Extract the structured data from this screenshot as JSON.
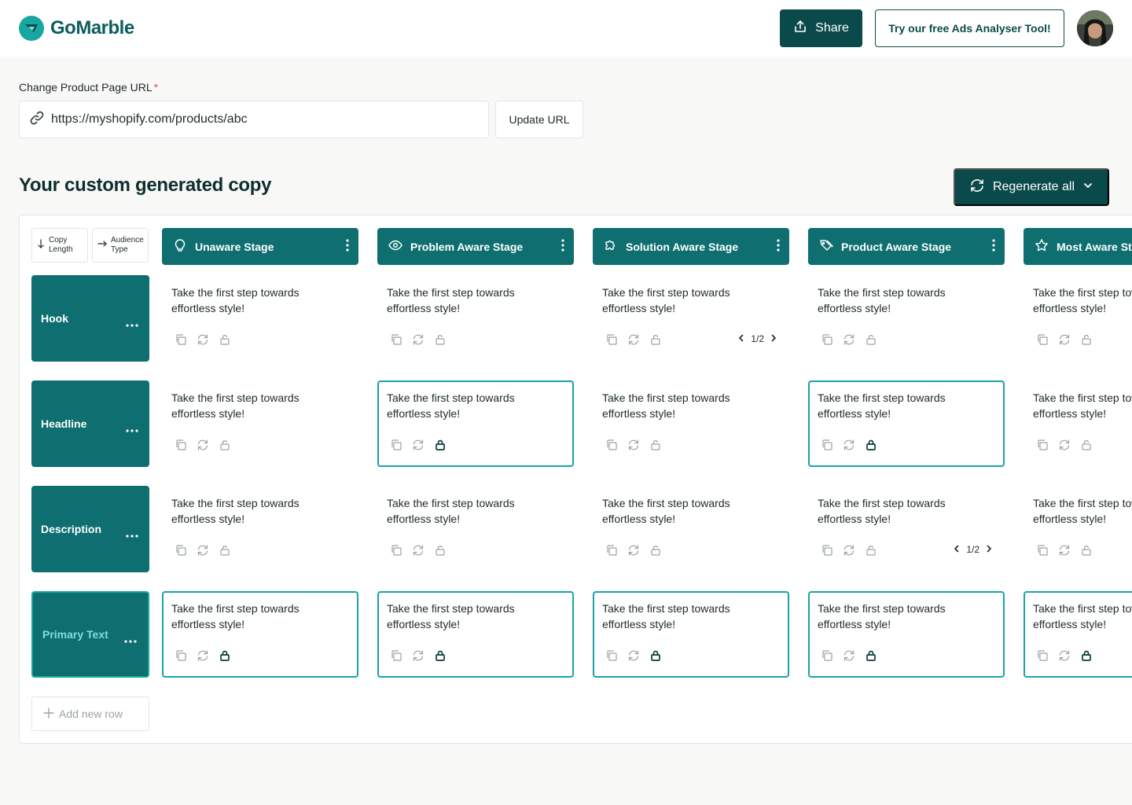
{
  "app": {
    "logo_text": "GoMarble",
    "share_label": "Share",
    "try_tool_label": "Try our free Ads Analyser Tool!"
  },
  "url_section": {
    "label": "Change Product Page URL",
    "required_mark": "*",
    "value": "https://myshopify.com/products/abc",
    "update_label": "Update URL"
  },
  "copy_section": {
    "title": "Your custom generated copy",
    "regenerate_label": "Regenerate all"
  },
  "sort": {
    "copy_length_line1": "Copy",
    "copy_length_line2": "Length",
    "audience_type_line1": "Audience",
    "audience_type_line2": "Type"
  },
  "stages": [
    {
      "label": "Unaware Stage",
      "icon": "lightbulb-icon"
    },
    {
      "label": "Problem Aware Stage",
      "icon": "eye-icon"
    },
    {
      "label": "Solution Aware Stage",
      "icon": "puzzle-icon"
    },
    {
      "label": "Product Aware Stage",
      "icon": "tags-icon"
    },
    {
      "label": "Most Aware Stage",
      "icon": "star-icon"
    }
  ],
  "rows": [
    {
      "label": "Hook"
    },
    {
      "label": "Headline"
    },
    {
      "label": "Description"
    },
    {
      "label": "Primary Text"
    }
  ],
  "cell_text": "Take the first step towards effortless style!",
  "cells": [
    [
      {
        "locked": false
      },
      {
        "locked": false
      },
      {
        "locked": false,
        "pager": "1/2"
      },
      {
        "locked": false
      },
      {
        "locked": false
      }
    ],
    [
      {
        "locked": false
      },
      {
        "locked": true
      },
      {
        "locked": false
      },
      {
        "locked": true
      },
      {
        "locked": false
      }
    ],
    [
      {
        "locked": false
      },
      {
        "locked": false
      },
      {
        "locked": false
      },
      {
        "locked": false,
        "pager": "1/2"
      },
      {
        "locked": false
      }
    ],
    [
      {
        "locked": true
      },
      {
        "locked": true
      },
      {
        "locked": true
      },
      {
        "locked": true
      },
      {
        "locked": true
      }
    ]
  ],
  "add_row_label": "Add new row",
  "colors": {
    "primary_dark": "#0b4a4b",
    "stage_teal": "#0e6e70",
    "locked_border": "#1aa3a8",
    "logo_accent": "#17a7a0"
  }
}
